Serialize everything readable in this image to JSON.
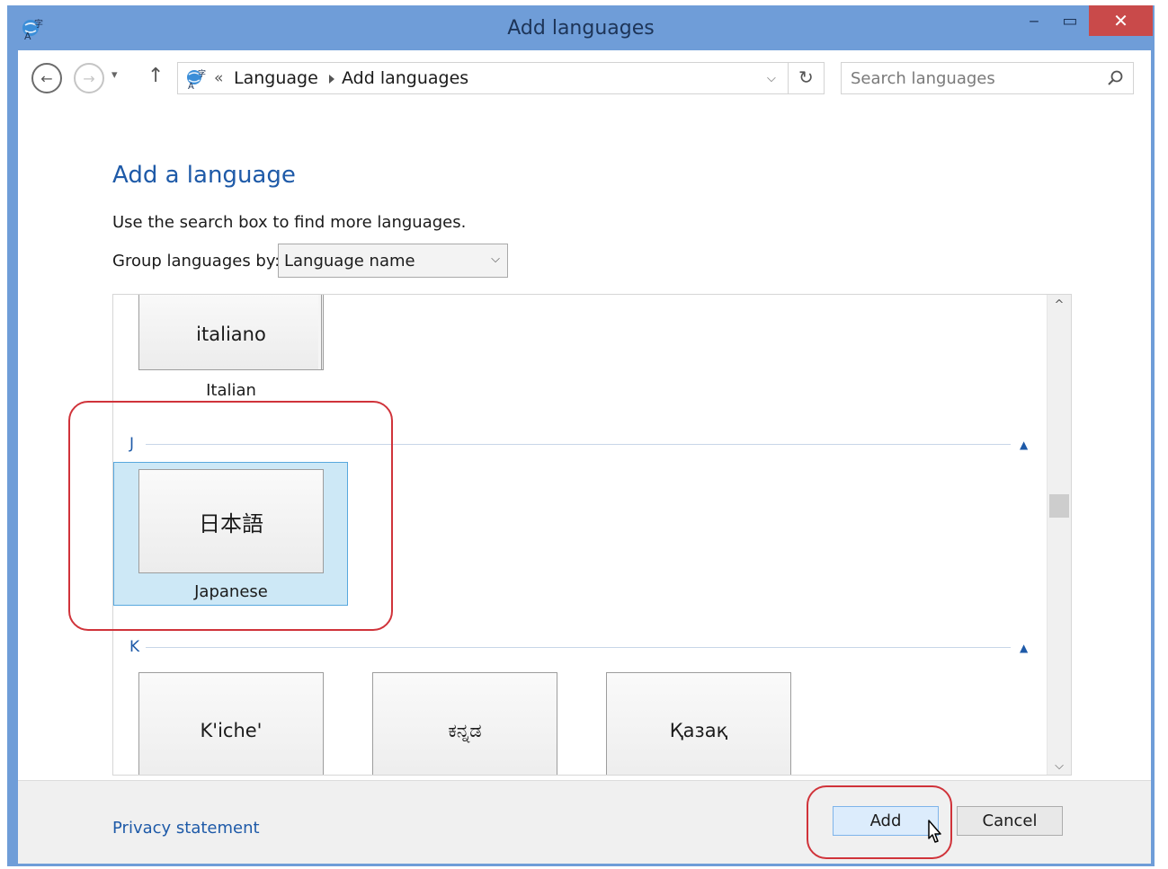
{
  "window": {
    "title": "Add languages",
    "minimize_glyph": "‒",
    "maximize_glyph": "▭",
    "close_glyph": "✕"
  },
  "nav": {
    "back_glyph": "←",
    "forward_glyph": "→",
    "recent_glyph": "▾",
    "up_glyph": "↑",
    "breadcrumb_overflow": "«",
    "breadcrumbs": [
      "Language",
      "Add languages"
    ],
    "dropdown_glyph": "⌵",
    "refresh_glyph": "↻",
    "search_placeholder": "Search languages"
  },
  "content": {
    "heading": "Add a language",
    "description": "Use the search box to find more languages.",
    "group_by_label": "Group languages by:",
    "group_by_value": "Language name",
    "group_by_chevron": "⌵"
  },
  "list": {
    "scroll_up_glyph": "^",
    "scroll_down_glyph": "⌵",
    "collapse_glyph": "▲",
    "italian": {
      "native": "italiano",
      "english": "Italian"
    },
    "group_j": {
      "letter": "J",
      "languages": [
        {
          "native": "日本語",
          "english": "Japanese",
          "selected": true
        }
      ]
    },
    "group_k": {
      "letter": "K",
      "languages": [
        {
          "native": "K'iche'"
        },
        {
          "native": "ಕನ್ನಡ"
        },
        {
          "native": "Қазақ"
        }
      ]
    }
  },
  "footer": {
    "privacy_link": "Privacy statement",
    "add_button": "Add",
    "cancel_button": "Cancel"
  },
  "colors": {
    "title_bar": "#6f9dd8",
    "close_button": "#c94a4a",
    "heading_blue": "#1e5aa8",
    "selection_fill": "#cde8f6",
    "selection_border": "#58a8de",
    "highlight_annotation": "#d0333a"
  }
}
